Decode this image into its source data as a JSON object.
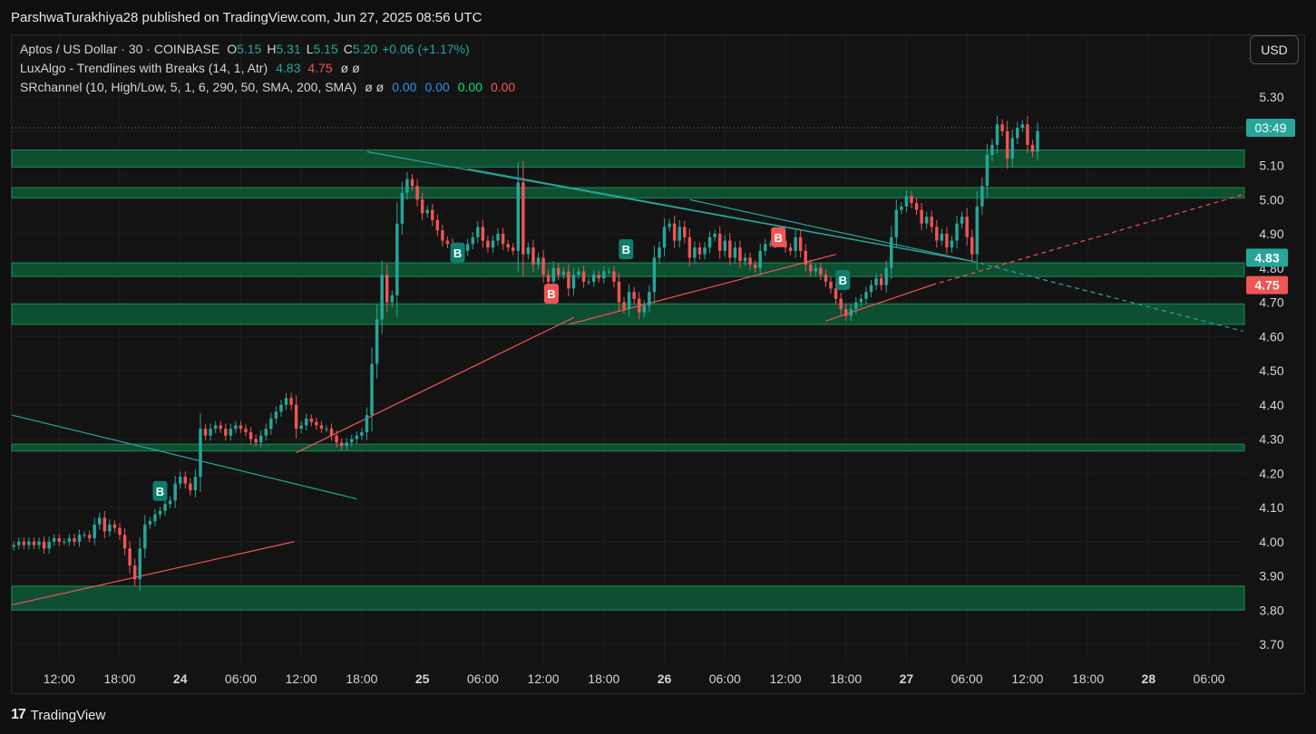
{
  "header": {
    "published_text": "ParshwaTurakhiya28 published on TradingView.com, Jun 27, 2025 08:56 UTC"
  },
  "legend": {
    "symbol": "Aptos / US Dollar · 30 · COINBASE",
    "o_label": "O",
    "o_value": "5.15",
    "h_label": "H",
    "h_value": "5.31",
    "l_label": "L",
    "l_value": "5.15",
    "c_label": "C",
    "c_value": "5.20",
    "change": "+0.06 (+1.17%)",
    "indicator1_name": "LuxAlgo - Trendlines with Breaks (14, 1, Atr)",
    "indicator1_v1": "4.83",
    "indicator1_v2": "4.75",
    "indicator1_null": "ø ø",
    "indicator2_name": "SRchannel (10, High/Low, 5, 1, 6, 290, 50, SMA, 200, SMA)",
    "indicator2_null": "ø ø",
    "indicator2_v1": "0.00",
    "indicator2_v2": "0.00",
    "indicator2_v3": "0.00",
    "indicator2_v4": "0.00"
  },
  "currency_button": "USD",
  "footer": {
    "brand": "TradingView",
    "logo": "17"
  },
  "colors": {
    "up": "#26a69a",
    "down": "#f05454",
    "zone": "#0e5a38",
    "zone_border": "#1a8a55",
    "teal_line": "#26a69a",
    "red_line": "#f05454",
    "grid": "#1e1e1e",
    "bg": "#131313"
  },
  "chart_data": {
    "type": "candlestick",
    "title": "Aptos / US Dollar · 30 · COINBASE",
    "ylim": [
      3.65,
      5.38
    ],
    "y_ticks": [
      "3.70",
      "3.80",
      "3.90",
      "4.00",
      "4.10",
      "4.20",
      "4.30",
      "4.40",
      "4.50",
      "4.60",
      "4.70",
      "4.80",
      "4.90",
      "5.00",
      "5.10",
      "5.20",
      "5.30"
    ],
    "y_tick_values": [
      3.7,
      3.8,
      3.9,
      4.0,
      4.1,
      4.2,
      4.3,
      4.4,
      4.5,
      4.6,
      4.7,
      4.8,
      4.9,
      5.0,
      5.1,
      5.2,
      5.3
    ],
    "x_ticks": [
      {
        "label": "12:00",
        "t": 12
      },
      {
        "label": "18:00",
        "t": 18
      },
      {
        "label": "24",
        "t": 24,
        "bold": true
      },
      {
        "label": "06:00",
        "t": 30
      },
      {
        "label": "12:00",
        "t": 36
      },
      {
        "label": "18:00",
        "t": 42
      },
      {
        "label": "25",
        "t": 48,
        "bold": true
      },
      {
        "label": "06:00",
        "t": 54
      },
      {
        "label": "12:00",
        "t": 60
      },
      {
        "label": "18:00",
        "t": 66
      },
      {
        "label": "26",
        "t": 72,
        "bold": true
      },
      {
        "label": "06:00",
        "t": 78
      },
      {
        "label": "12:00",
        "t": 84
      },
      {
        "label": "18:00",
        "t": 90
      },
      {
        "label": "27",
        "t": 96,
        "bold": true
      },
      {
        "label": "06:00",
        "t": 102
      },
      {
        "label": "12:00",
        "t": 108
      },
      {
        "label": "18:00",
        "t": 114
      },
      {
        "label": "28",
        "t": 120,
        "bold": true
      },
      {
        "label": "06:00",
        "t": 126
      }
    ],
    "x_range_hours": [
      7.3,
      129.5
    ],
    "candles_hours_start": 7.5,
    "candle_interval_hours": 0.5,
    "closes": [
      3.99,
      4.0,
      3.99,
      4.0,
      3.99,
      4.0,
      3.98,
      4.0,
      4.01,
      4.0,
      4.0,
      4.01,
      4.0,
      4.02,
      4.02,
      4.01,
      4.05,
      4.07,
      4.03,
      4.05,
      4.04,
      4.02,
      3.98,
      3.93,
      3.89,
      3.98,
      4.05,
      4.06,
      4.08,
      4.09,
      4.11,
      4.12,
      4.17,
      4.19,
      4.17,
      4.15,
      4.19,
      4.33,
      4.31,
      4.33,
      4.34,
      4.33,
      4.31,
      4.33,
      4.34,
      4.33,
      4.32,
      4.3,
      4.29,
      4.31,
      4.33,
      4.36,
      4.38,
      4.4,
      4.42,
      4.4,
      4.33,
      4.34,
      4.36,
      4.35,
      4.34,
      4.33,
      4.33,
      4.31,
      4.29,
      4.28,
      4.29,
      4.3,
      4.31,
      4.32,
      4.37,
      4.52,
      4.65,
      4.78,
      4.7,
      4.72,
      4.93,
      5.02,
      5.06,
      5.04,
      5.0,
      4.96,
      4.97,
      4.94,
      4.91,
      4.88,
      4.87,
      4.84,
      4.86,
      4.85,
      4.87,
      4.89,
      4.92,
      4.88,
      4.86,
      4.88,
      4.9,
      4.87,
      4.86,
      4.85,
      5.05,
      4.84,
      4.86,
      4.81,
      4.83,
      4.78,
      4.76,
      4.8,
      4.78,
      4.79,
      4.74,
      4.78,
      4.79,
      4.76,
      4.76,
      4.78,
      4.77,
      4.79,
      4.79,
      4.76,
      4.7,
      4.68,
      4.73,
      4.71,
      4.67,
      4.69,
      4.73,
      4.83,
      4.86,
      4.92,
      4.93,
      4.88,
      4.92,
      4.89,
      4.83,
      4.86,
      4.84,
      4.86,
      4.89,
      4.9,
      4.85,
      4.88,
      4.83,
      4.86,
      4.82,
      4.83,
      4.81,
      4.8,
      4.85,
      4.87,
      4.87,
      4.88,
      4.88,
      4.86,
      4.85,
      4.89,
      4.85,
      4.81,
      4.79,
      4.8,
      4.78,
      4.76,
      4.74,
      4.71,
      4.68,
      4.66,
      4.68,
      4.7,
      4.71,
      4.73,
      4.75,
      4.77,
      4.75,
      4.8,
      4.89,
      4.97,
      4.98,
      5.01,
      4.99,
      4.97,
      4.93,
      4.95,
      4.92,
      4.88,
      4.9,
      4.86,
      4.88,
      4.93,
      4.95,
      4.89,
      4.84,
      4.98,
      5.04,
      5.13,
      5.16,
      5.22,
      5.2,
      5.12,
      5.18,
      5.21,
      5.22,
      5.16,
      5.14,
      5.2
    ],
    "price_line": {
      "value": 5.21,
      "label": "03:49"
    },
    "sr_zones": [
      [
        5.095,
        5.145
      ],
      [
        5.005,
        5.035
      ],
      [
        4.775,
        4.815
      ],
      [
        4.635,
        4.695
      ],
      [
        4.265,
        4.285
      ],
      [
        3.8,
        3.87
      ]
    ],
    "teal_trendlines": [
      {
        "from": [
          7.3,
          4.37
        ],
        "to": [
          41.5,
          4.125
        ]
      },
      {
        "from": [
          42.5,
          5.14
        ],
        "to": [
          102.5,
          4.82
        ]
      },
      {
        "from": [
          52.5,
          5.09
        ],
        "to": [
          102.5,
          4.82
        ]
      },
      {
        "from": [
          74.5,
          5.0
        ],
        "to": [
          102.5,
          4.82
        ]
      }
    ],
    "teal_dashed": {
      "from": [
        102.5,
        4.82
      ],
      "to": [
        129.4,
        4.615
      ]
    },
    "red_trendlines": [
      {
        "from": [
          7.3,
          3.815
        ],
        "to": [
          35.3,
          4.0
        ]
      },
      {
        "from": [
          35.5,
          4.26
        ],
        "to": [
          63.0,
          4.655
        ]
      },
      {
        "from": [
          62.5,
          4.635
        ],
        "to": [
          89.0,
          4.84
        ]
      },
      {
        "from": [
          88.0,
          4.645
        ],
        "to": [
          98.5,
          4.75
        ]
      }
    ],
    "red_dashed": {
      "from": [
        98.5,
        4.75
      ],
      "to": [
        129.4,
        5.015
      ]
    },
    "break_markers": [
      {
        "t": 22.0,
        "price": 4.148,
        "type": "bull",
        "label": "B"
      },
      {
        "t": 51.5,
        "price": 4.845,
        "type": "bull",
        "label": "B"
      },
      {
        "t": 60.8,
        "price": 4.725,
        "type": "bear",
        "label": "B"
      },
      {
        "t": 68.2,
        "price": 4.855,
        "type": "bull",
        "label": "B"
      },
      {
        "t": 83.3,
        "price": 4.89,
        "type": "bear",
        "label": "B"
      },
      {
        "t": 89.7,
        "price": 4.765,
        "type": "bull",
        "label": "B"
      }
    ],
    "axis_labels": [
      {
        "value": 4.83,
        "text": "4.83",
        "type": "bull"
      },
      {
        "value": 4.75,
        "text": "4.75",
        "type": "bear"
      }
    ]
  }
}
